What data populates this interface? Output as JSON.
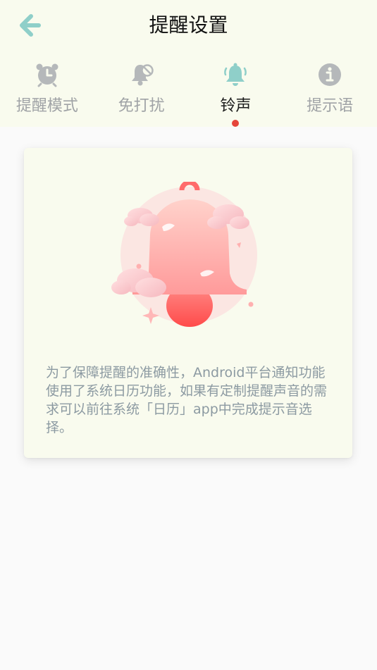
{
  "header": {
    "title": "提醒设置",
    "back_icon": "arrow-left-icon",
    "accent_color": "#8fcfc9"
  },
  "tabs": [
    {
      "label": "提醒模式",
      "icon": "alarm-clock-icon",
      "active": false
    },
    {
      "label": "免打扰",
      "icon": "bell-off-icon",
      "active": false
    },
    {
      "label": "铃声",
      "icon": "bell-icon",
      "active": true
    },
    {
      "label": "提示语",
      "icon": "info-icon",
      "active": false
    }
  ],
  "card": {
    "illustration": "ringing-bell-illustration",
    "description": "为了保障提醒的准确性，Android平台通知功能使用了系统日历功能，如果有定制提醒声音的需求可以前往系统「日历」app中完成提示音选择。"
  },
  "colors": {
    "header_bg": "#f9fbee",
    "page_bg": "#fafafa",
    "active_tab_dot": "#e5453b",
    "inactive_tab_text": "#a0a3a6",
    "description_text": "#8c9aa2"
  }
}
